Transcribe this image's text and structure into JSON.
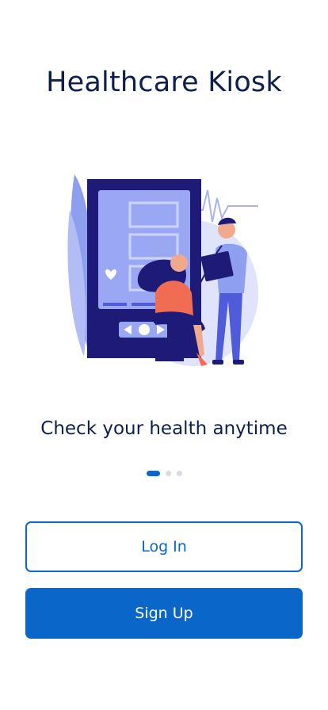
{
  "header": {
    "title": "Healthcare Kiosk"
  },
  "illustration": {
    "icon": "doctor-blood-pressure-illustration"
  },
  "onboarding": {
    "tagline": "Check your health anytime",
    "pager": {
      "total": 3,
      "active": 1
    }
  },
  "actions": {
    "login_label": "Log In",
    "signup_label": "Sign Up"
  },
  "colors": {
    "primary": "#0a66c9",
    "text": "#0f1f4b",
    "illustration_dark": "#1e1a78",
    "illustration_light": "#dfe3fb"
  }
}
